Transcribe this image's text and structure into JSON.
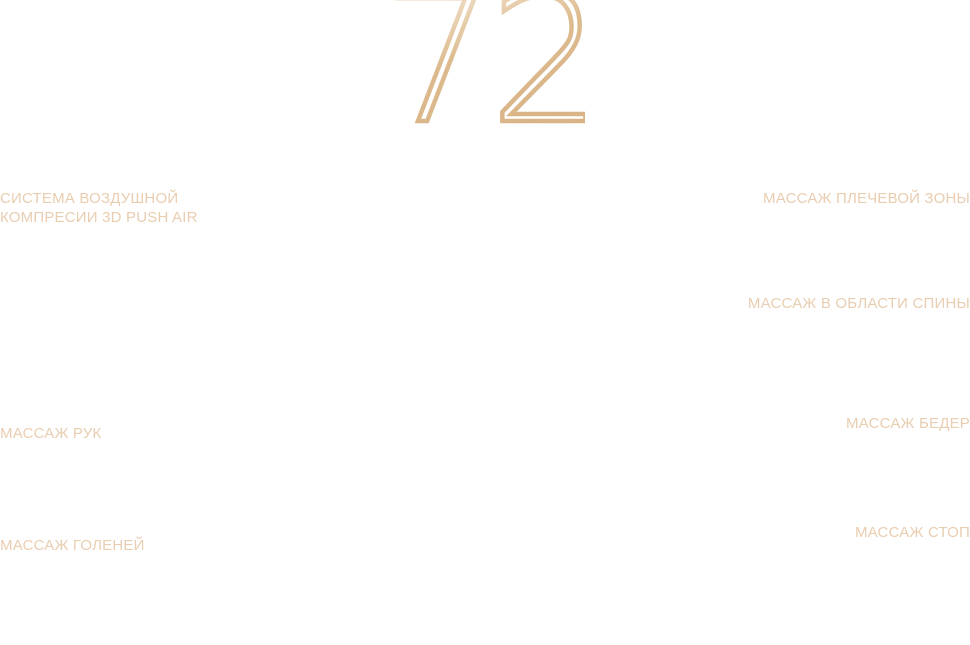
{
  "colors": {
    "accent": "#e9cdb0",
    "number_gold": "#ddbb8e",
    "background": "#ffffff"
  },
  "hero": {
    "number": "72"
  },
  "features": {
    "air_compression": {
      "line1": "СИСТЕМА ВОЗДУШНОЙ",
      "line2": "КОМПРЕСИИ 3D PUSH AIR"
    },
    "shoulder": "МАССАЖ ПЛЕЧЕВОЙ ЗОНЫ",
    "back": "МАССАЖ В ОБЛАСТИ СПИНЫ",
    "arms": "МАССАЖ РУК",
    "hips": "МАССАЖ БЕДЕР",
    "shins": "МАССАЖ ГОЛЕНЕЙ",
    "feet": "МАССАЖ СТОП"
  }
}
